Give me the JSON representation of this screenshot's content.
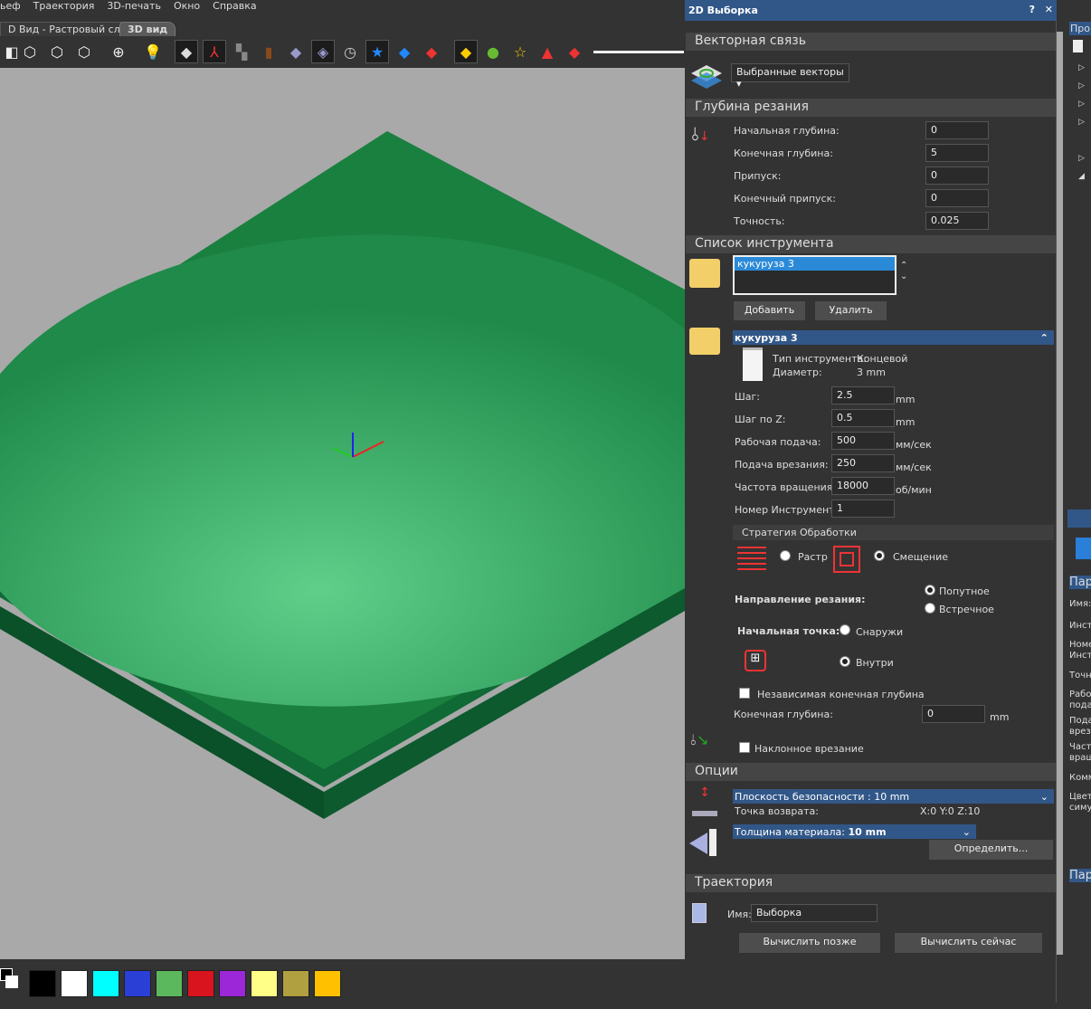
{
  "menu": [
    "ьеф",
    "Траектория",
    "3D-печать",
    "Окно",
    "Справка"
  ],
  "tabs": [
    {
      "label": "D Вид - Растровый слой"
    },
    {
      "label": "3D вид"
    }
  ],
  "toolbar_icons": [
    "view-iso-icon",
    "cube-front-icon",
    "cube-side-icon",
    "cube-top-icon",
    "zoom-icon",
    "light-icon",
    "material-icon",
    "axes-icon",
    "puzzle-icon",
    "cylinder-icon",
    "block-icon",
    "tool-preview-icon",
    "timer-icon",
    "star-icon",
    "layer-blue-icon",
    "layer-red-icon",
    "plane-yellow-icon",
    "shapes-icon",
    "star-search-icon",
    "pyramid-icon",
    "stack-icon"
  ],
  "palette": [
    "#000000",
    "#ffffff",
    "#00ffff",
    "#2a3fd6",
    "#5cb85c",
    "#d9141e",
    "#9b27d9",
    "#ffff88",
    "#b0a040",
    "#ffc000"
  ],
  "panel": {
    "title": "2D Выборка",
    "help": "?",
    "close": "✕",
    "vector_section": "Векторная связь",
    "vector_select": "Выбранные векторы",
    "depth_section": "Глубина резания",
    "depth_fields": [
      {
        "label": "Начальная глубина:",
        "value": "0"
      },
      {
        "label": "Конечная глубина:",
        "value": "5"
      },
      {
        "label": "Припуск:",
        "value": "0"
      },
      {
        "label": "Конечный припуск:",
        "value": "0"
      },
      {
        "label": "Точность:",
        "value": "0.025"
      }
    ],
    "tools_section": "Список инструмента",
    "tool_list": [
      "кукуруза 3"
    ],
    "add": "Добавить",
    "delete": "Удалить",
    "tool": {
      "name": "кукуруза 3",
      "type_label": "Тип инструмента:",
      "type": "Концевой",
      "diam_label": "Диаметр:",
      "diam": "3 mm",
      "fields": [
        {
          "label": "Шаг:",
          "value": "2.5",
          "unit": "mm"
        },
        {
          "label": "Шаг по Z:",
          "value": "0.5",
          "unit": "mm"
        },
        {
          "label": "Рабочая подача:",
          "value": "500",
          "unit": "мм/сек"
        },
        {
          "label": "Подача врезания:",
          "value": "250",
          "unit": "мм/сек"
        },
        {
          "label": "Частота вращения:",
          "value": "18000",
          "unit": "об/мин"
        },
        {
          "label": "Номер Инструмента:",
          "value": "1",
          "unit": ""
        }
      ]
    },
    "strategy": "Стратегия Обработки",
    "raster": "Растр",
    "offset": "Смещение",
    "direction_label": "Направление резания:",
    "climb": "Попутное",
    "conventional": "Встречное",
    "start_label": "Начальная точка:",
    "outside": "Снаружи",
    "inside": "Внутри",
    "independent": "Независимая конечная глубина",
    "final_depth_label": "Конечная глубина:",
    "final_depth": "0",
    "final_unit": "mm",
    "ramp": "Наклонное врезание",
    "options_section": "Опции",
    "safe_plane": "Плоскость безопасности : 10 mm",
    "home_label": "Точка возврата:",
    "home": "X:0 Y:0 Z:10",
    "thickness_label": "Толщина материала:",
    "thickness": "10 mm",
    "define": "Определить...",
    "path_section": "Траектория",
    "name_label": "Имя:",
    "name": "Выборка",
    "calc_later": "Вычислить позже",
    "calc_now": "Вычислить сейчас"
  },
  "right": {
    "header": "Про",
    "params1": "Пар",
    "params2": "Пар",
    "rows": [
      "Имя:",
      "Инст",
      "Номе Инст",
      "Точн",
      "Рабо пода",
      "Пода вреза",
      "Част враш",
      "Комм",
      "Цвет симу."
    ]
  }
}
